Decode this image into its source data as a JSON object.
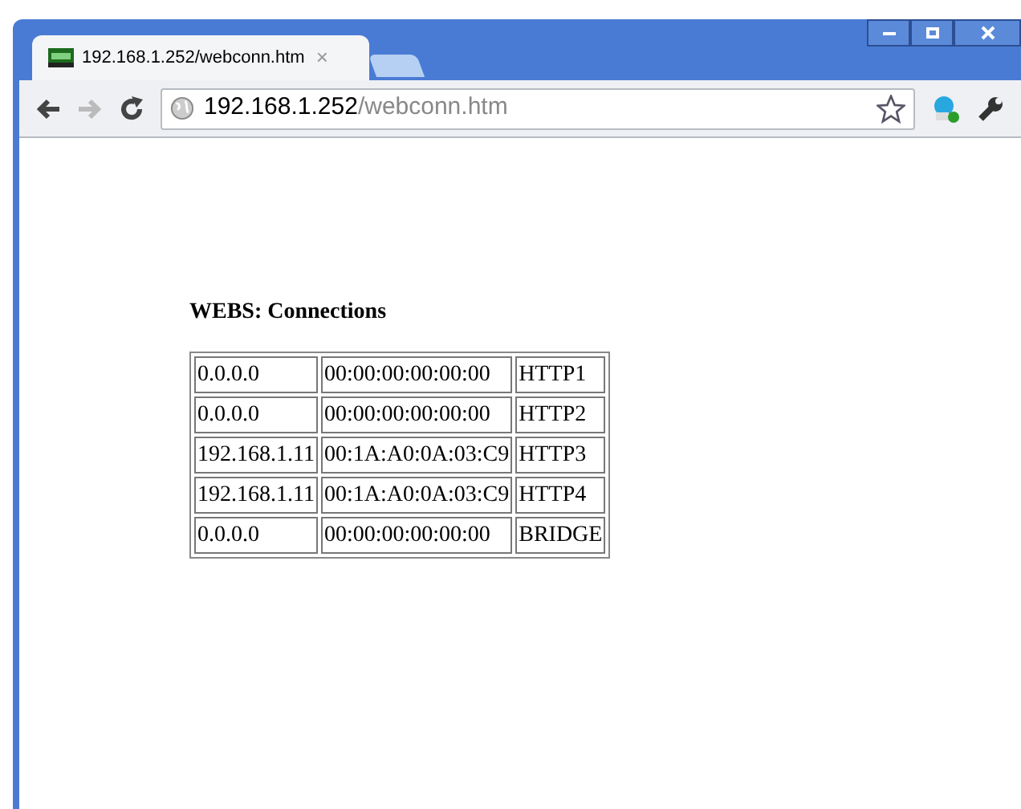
{
  "tab": {
    "title": "192.168.1.252/webconn.htm",
    "close": "×",
    "selected": true
  },
  "address_bar": {
    "host": "192.168.1.252",
    "path": "/webconn.htm"
  },
  "page": {
    "heading": "WEBS: Connections",
    "table": {
      "rows": [
        [
          "0.0.0.0",
          "00:00:00:00:00:00",
          "HTTP1"
        ],
        [
          "0.0.0.0",
          "00:00:00:00:00:00",
          "HTTP2"
        ],
        [
          "192.168.1.11",
          "00:1A:A0:0A:03:C9",
          "HTTP3"
        ],
        [
          "192.168.1.11",
          "00:1A:A0:0A:03:C9",
          "HTTP4"
        ],
        [
          "0.0.0.0",
          "00:00:00:00:00:00",
          "BRIDGE"
        ]
      ]
    }
  }
}
